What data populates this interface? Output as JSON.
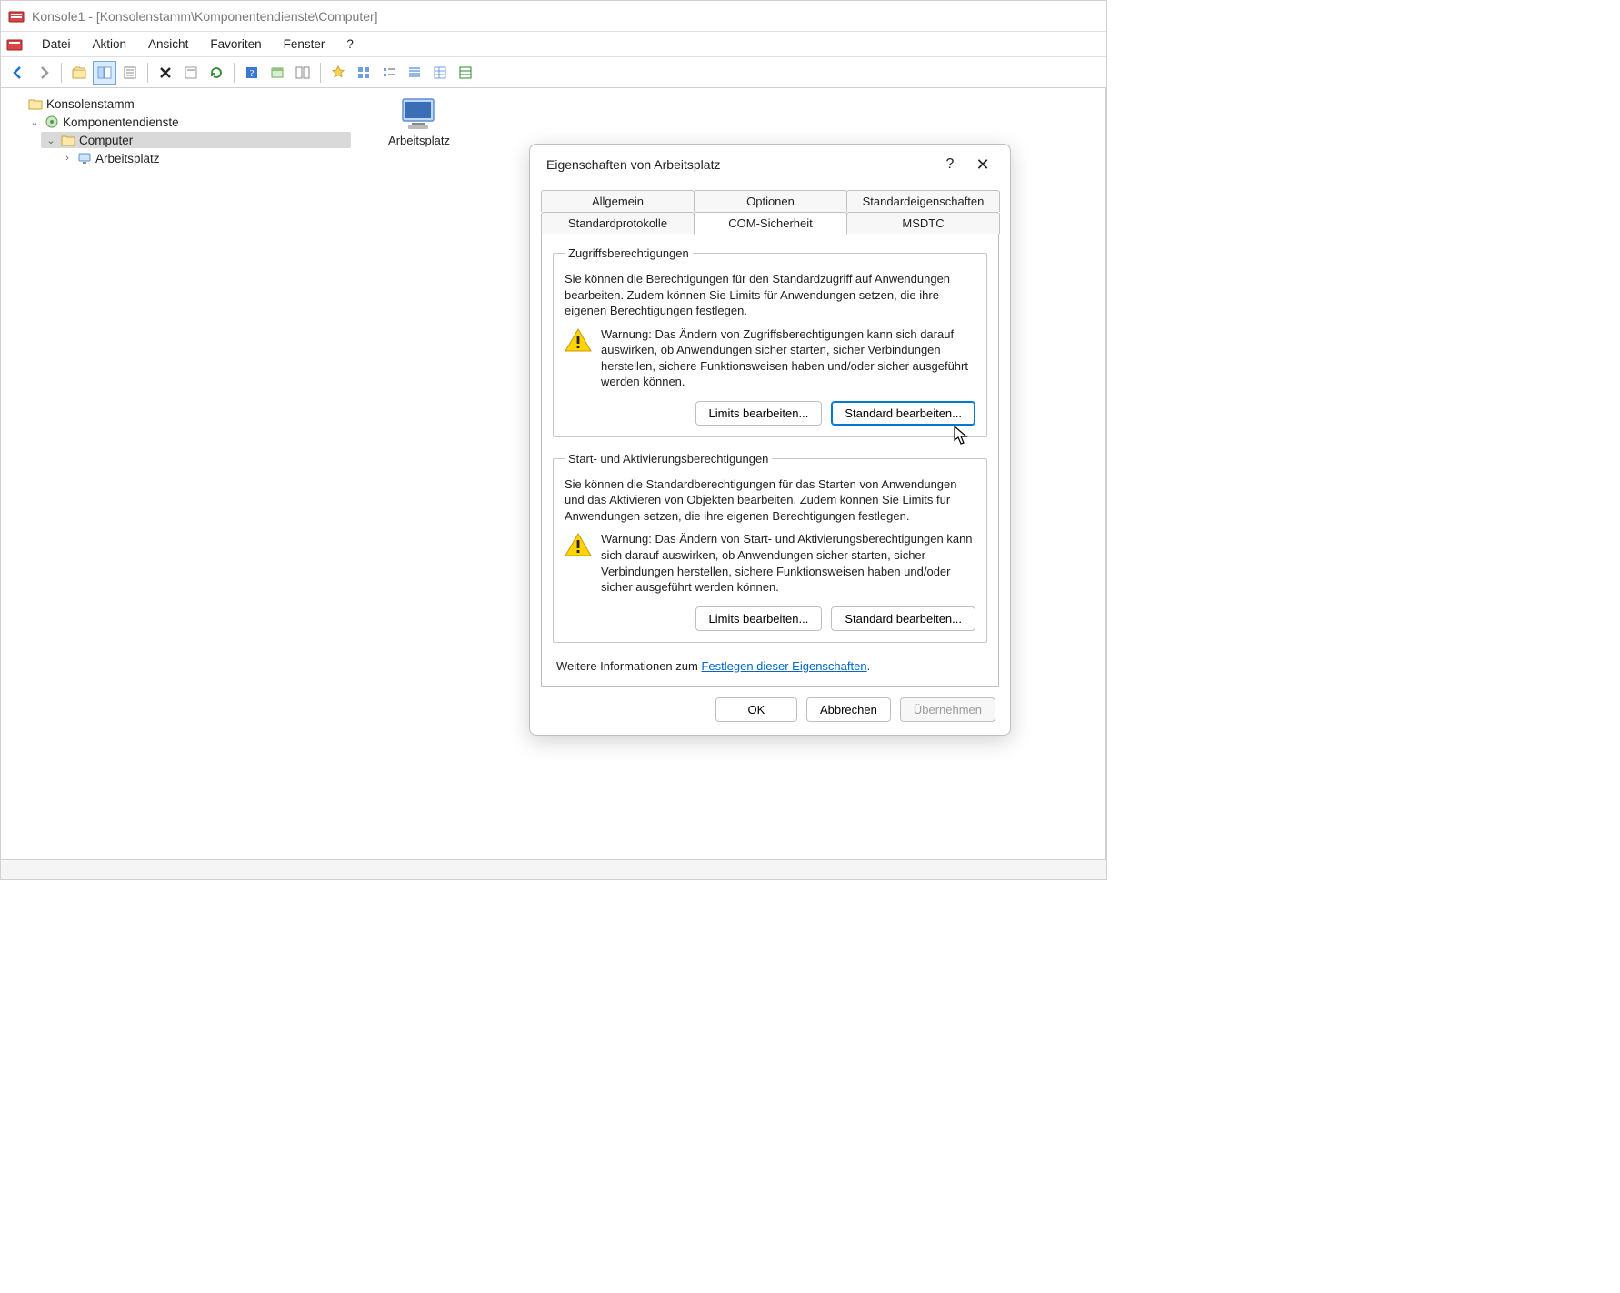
{
  "window": {
    "title": "Konsole1 - [Konsolenstamm\\Komponentendienste\\Computer]"
  },
  "menu": {
    "items": [
      "Datei",
      "Aktion",
      "Ansicht",
      "Favoriten",
      "Fenster",
      "?"
    ]
  },
  "tree": {
    "root": "Konsolenstamm",
    "node1": "Komponentendienste",
    "node2": "Computer",
    "node3": "Arbeitsplatz"
  },
  "content": {
    "item_label": "Arbeitsplatz"
  },
  "dialog": {
    "title": "Eigenschaften von Arbeitsplatz",
    "tabs_row1": [
      "Allgemein",
      "Optionen",
      "Standardeigenschaften"
    ],
    "tabs_row2": [
      "Standardprotokolle",
      "COM-Sicherheit",
      "MSDTC"
    ],
    "group1": {
      "legend": "Zugriffsberechtigungen",
      "text": "Sie können die Berechtigungen für den Standardzugriff auf Anwendungen bearbeiten. Zudem können Sie Limits für Anwendungen setzen, die ihre eigenen Berechtigungen festlegen.",
      "warn": "Warnung: Das Ändern von Zugriffsberechtigungen kann sich darauf auswirken, ob Anwendungen sicher starten, sicher Verbindungen herstellen, sichere Funktionsweisen haben und/oder sicher ausgeführt werden können.",
      "btn_limits": "Limits bearbeiten...",
      "btn_default": "Standard bearbeiten..."
    },
    "group2": {
      "legend": "Start- und Aktivierungsberechtigungen",
      "text": "Sie können die Standardberechtigungen für das Starten von Anwendungen und das Aktivieren von Objekten bearbeiten. Zudem können Sie Limits für Anwendungen setzen, die ihre eigenen Berechtigungen festlegen.",
      "warn": "Warnung: Das Ändern von Start- und Aktivierungsberechtigungen kann sich darauf auswirken, ob Anwendungen sicher starten, sicher Verbindungen herstellen, sichere Funktionsweisen haben und/oder sicher ausgeführt werden können.",
      "btn_limits": "Limits bearbeiten...",
      "btn_default": "Standard bearbeiten..."
    },
    "info_prefix": "Weitere Informationen zum ",
    "info_link": "Festlegen dieser Eigenschaften",
    "info_suffix": ".",
    "btn_ok": "OK",
    "btn_cancel": "Abbrechen",
    "btn_apply": "Übernehmen"
  }
}
